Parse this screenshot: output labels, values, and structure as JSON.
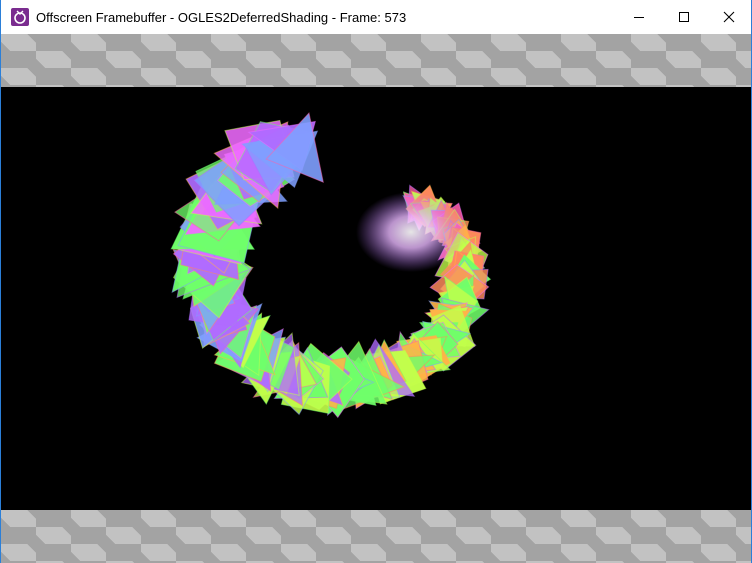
{
  "window": {
    "title": "Offscreen Framebuffer - OGLES2DeferredShading - Frame: 573",
    "app_icon": "powervr-app-icon",
    "controls": [
      "minimize-icon",
      "maximize-icon",
      "close-icon"
    ]
  },
  "render": {
    "background": "#000000",
    "subject": "normal-mapped spiral geometry",
    "palette": [
      "#ff5fa8",
      "#ff8a5c",
      "#ffb347",
      "#c2ff4a",
      "#6fff6a",
      "#b06bff",
      "#7fa0ff",
      "#f06bff"
    ]
  },
  "checker": {
    "light": "#c2c2c2",
    "dark": "#a3a3a3"
  }
}
